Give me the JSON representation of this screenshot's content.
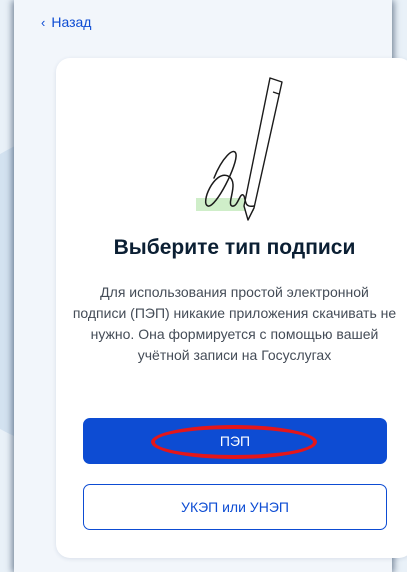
{
  "nav": {
    "back_label": "Назад"
  },
  "content": {
    "title": "Выберите тип подписи",
    "description": "Для использования простой электронной подписи (ПЭП) никакие приложения скачивать не нужно. Она формируется с помощью вашей учётной записи на Госуслугах"
  },
  "buttons": {
    "primary_label": "ПЭП",
    "secondary_label": "УКЭП или УНЭП"
  },
  "colors": {
    "accent": "#0d4cd3",
    "highlight": "#e4161a",
    "title": "#0b1f33"
  },
  "icons": {
    "back": "chevron-left-icon",
    "illustration": "pen-signature-illustration"
  }
}
